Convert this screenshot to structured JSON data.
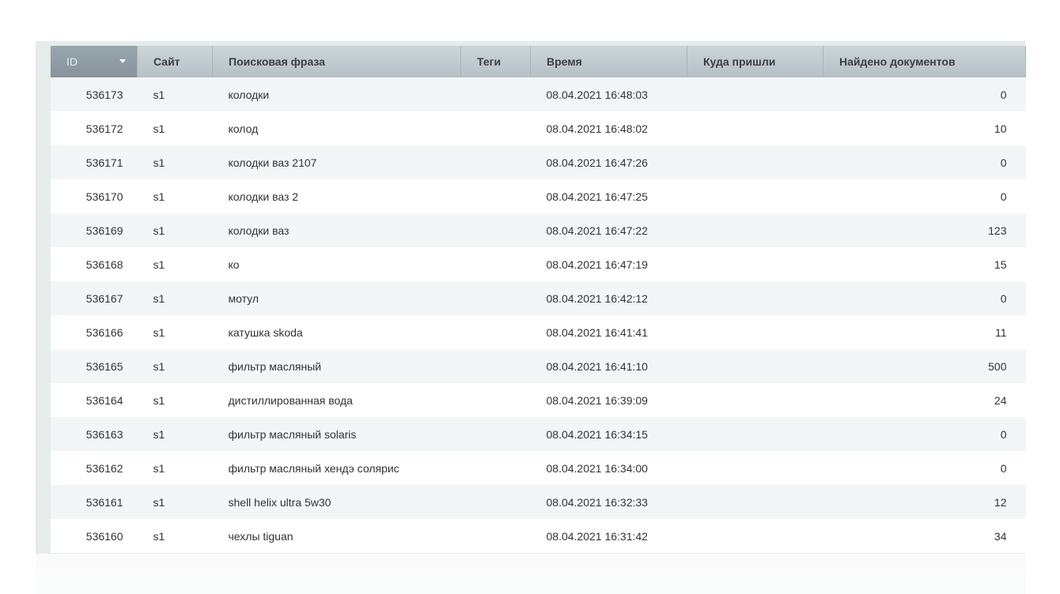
{
  "columns": {
    "id": "ID",
    "site": "Сайт",
    "phrase": "Поисковая фраза",
    "tags": "Теги",
    "time": "Время",
    "destination": "Куда пришли",
    "found": "Найдено документов"
  },
  "rows": [
    {
      "id": "536173",
      "site": "s1",
      "phrase": "колодки",
      "tags": "",
      "time": "08.04.2021 16:48:03",
      "destination": "",
      "found": "0"
    },
    {
      "id": "536172",
      "site": "s1",
      "phrase": "колод",
      "tags": "",
      "time": "08.04.2021 16:48:02",
      "destination": "",
      "found": "10"
    },
    {
      "id": "536171",
      "site": "s1",
      "phrase": "колодки ваз 2107",
      "tags": "",
      "time": "08.04.2021 16:47:26",
      "destination": "",
      "found": "0"
    },
    {
      "id": "536170",
      "site": "s1",
      "phrase": "колодки ваз 2",
      "tags": "",
      "time": "08.04.2021 16:47:25",
      "destination": "",
      "found": "0"
    },
    {
      "id": "536169",
      "site": "s1",
      "phrase": "колодки ваз",
      "tags": "",
      "time": "08.04.2021 16:47:22",
      "destination": "",
      "found": "123"
    },
    {
      "id": "536168",
      "site": "s1",
      "phrase": "ко",
      "tags": "",
      "time": "08.04.2021 16:47:19",
      "destination": "",
      "found": "15"
    },
    {
      "id": "536167",
      "site": "s1",
      "phrase": "мотул",
      "tags": "",
      "time": "08.04.2021 16:42:12",
      "destination": "",
      "found": "0"
    },
    {
      "id": "536166",
      "site": "s1",
      "phrase": "катушка skoda",
      "tags": "",
      "time": "08.04.2021 16:41:41",
      "destination": "",
      "found": "11"
    },
    {
      "id": "536165",
      "site": "s1",
      "phrase": "фильтр масляный",
      "tags": "",
      "time": "08.04.2021 16:41:10",
      "destination": "",
      "found": "500"
    },
    {
      "id": "536164",
      "site": "s1",
      "phrase": "дистиллированная вода",
      "tags": "",
      "time": "08.04.2021 16:39:09",
      "destination": "",
      "found": "24"
    },
    {
      "id": "536163",
      "site": "s1",
      "phrase": "фильтр масляный solaris",
      "tags": "",
      "time": "08.04.2021 16:34:15",
      "destination": "",
      "found": "0"
    },
    {
      "id": "536162",
      "site": "s1",
      "phrase": "фильтр масляный хендэ солярис",
      "tags": "",
      "time": "08.04.2021 16:34:00",
      "destination": "",
      "found": "0"
    },
    {
      "id": "536161",
      "site": "s1",
      "phrase": "shell helix ultra 5w30",
      "tags": "",
      "time": "08.04.2021 16:32:33",
      "destination": "",
      "found": "12"
    },
    {
      "id": "536160",
      "site": "s1",
      "phrase": "чехлы tiguan",
      "tags": "",
      "time": "08.04.2021 16:31:42",
      "destination": "",
      "found": "34"
    }
  ]
}
